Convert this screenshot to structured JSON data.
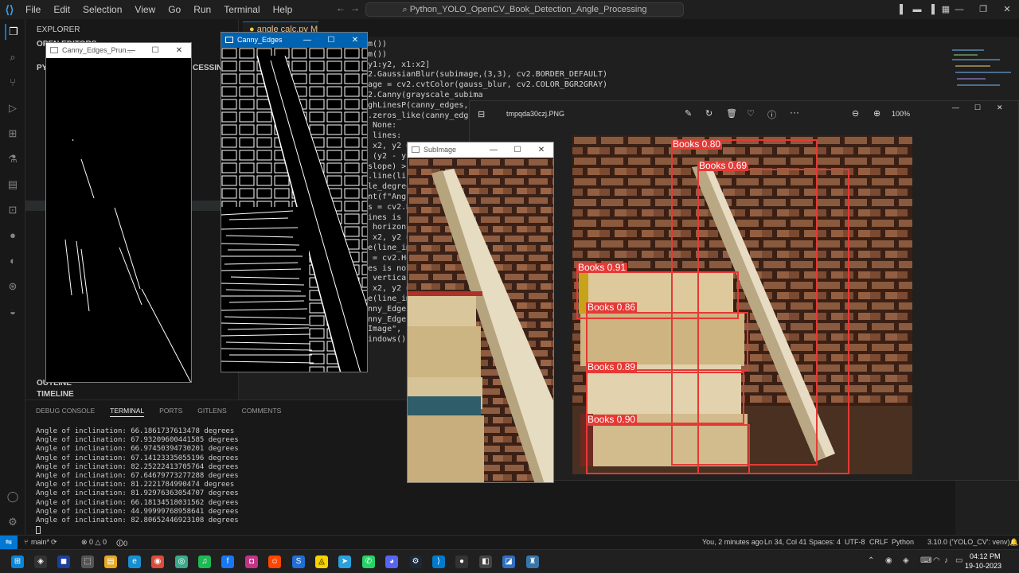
{
  "app": {
    "menu": [
      "File",
      "Edit",
      "Selection",
      "View",
      "Go",
      "Run",
      "Terminal",
      "Help"
    ],
    "command_center": "Python_YOLO_OpenCV_Book_Detection_Angle_Processing"
  },
  "sidebar": {
    "title": "EXPLORER",
    "open_editors": "OPEN EDITORS",
    "project": "PYT",
    "processing": "CESSING",
    "outline": "OUTLINE",
    "timeline": "TIMELINE"
  },
  "editor": {
    "tab_label": "angle calc.py M",
    "code_lines": [
      "m())",
      "m())",
      "y1:y2, x1:x2]",
      "2.GaussianBlur(subimage,(3,3), cv2.BORDER_DEFAULT)",
      "age = cv2.cvtColor(gauss_blur, cv2.COLOR_BGR2GRAY)",
      "2.Canny(grayscale_subima",
      "ghLinesP(canny_edges, 1,",
      ".zeros_like(canny_edges)",
      " None:",
      " lines:",
      " x2, y2 =",
      " (y2 - y1",
      "slope) >",
      ".line(lin",
      "le_degree",
      "nt(f\"Angl",
      "s = cv2.Ho",
      "ines is no",
      " horizont",
      " x2, y2 =",
      "e(line_im",
      " = cv2.Hou",
      "es is not",
      " vertical",
      " x2, y2 =",
      "e(line_im",
      "nny_Edges\"",
      "nny_Edges_",
      "Image\", su",
      "",
      "indows()"
    ]
  },
  "panel": {
    "tabs": [
      "DEBUG CONSOLE",
      "TERMINAL",
      "PORTS",
      "GITLENS",
      "COMMENTS"
    ],
    "terminal_lines": [
      "Angle of inclination: 66.1861737613478 degrees",
      "Angle of inclination: 67.93209600441585 degrees",
      "Angle of inclination: 66.97450394730201 degrees",
      "Angle of inclination: 67.14123335055196 degrees",
      "Angle of inclination: 82.25222413705764 degrees",
      "Angle of inclination: 67.64679773277288 degrees",
      "Angle of inclination: 81.2221784990474 degrees",
      "Angle of inclination: 81.92976363054707 degrees",
      "Angle of inclination: 66.18134518031562 degrees",
      "Angle of inclination: 44.99999768958641 degrees",
      "Angle of inclination: 82.80652446923108 degrees"
    ]
  },
  "status": {
    "branch": "main*",
    "errors": "⊗ 0 △ 0",
    "ports": "🛈0",
    "blame": "You, 2 minutes ago",
    "position": "Ln 34, Col 41",
    "spaces": "Spaces: 4",
    "encoding": "UTF-8",
    "eol": "CRLF",
    "language": "Python",
    "interpreter": "3.10.0 ('YOLO_CV': venv)"
  },
  "windows": {
    "canny_pruned_title": "Canny_Edges_Prun...",
    "canny_title": "Canny_Edges",
    "subimage_title": "SubImage",
    "photos_filename": "tmpqda30czj.PNG",
    "photos_zoom": "100%"
  },
  "detections": [
    {
      "label": "Books 0.80"
    },
    {
      "label": "Books 0.69"
    },
    {
      "label": "Books 0.91"
    },
    {
      "label": "Books 0.86"
    },
    {
      "label": "Books 0.89"
    },
    {
      "label": "Books 0.90"
    }
  ],
  "taskbar": {
    "time": "04:12 PM",
    "date": "19-10-2023"
  },
  "colors": {
    "accent": "#0078d4",
    "bbox": "#e53935",
    "statusbar": "#181818"
  }
}
